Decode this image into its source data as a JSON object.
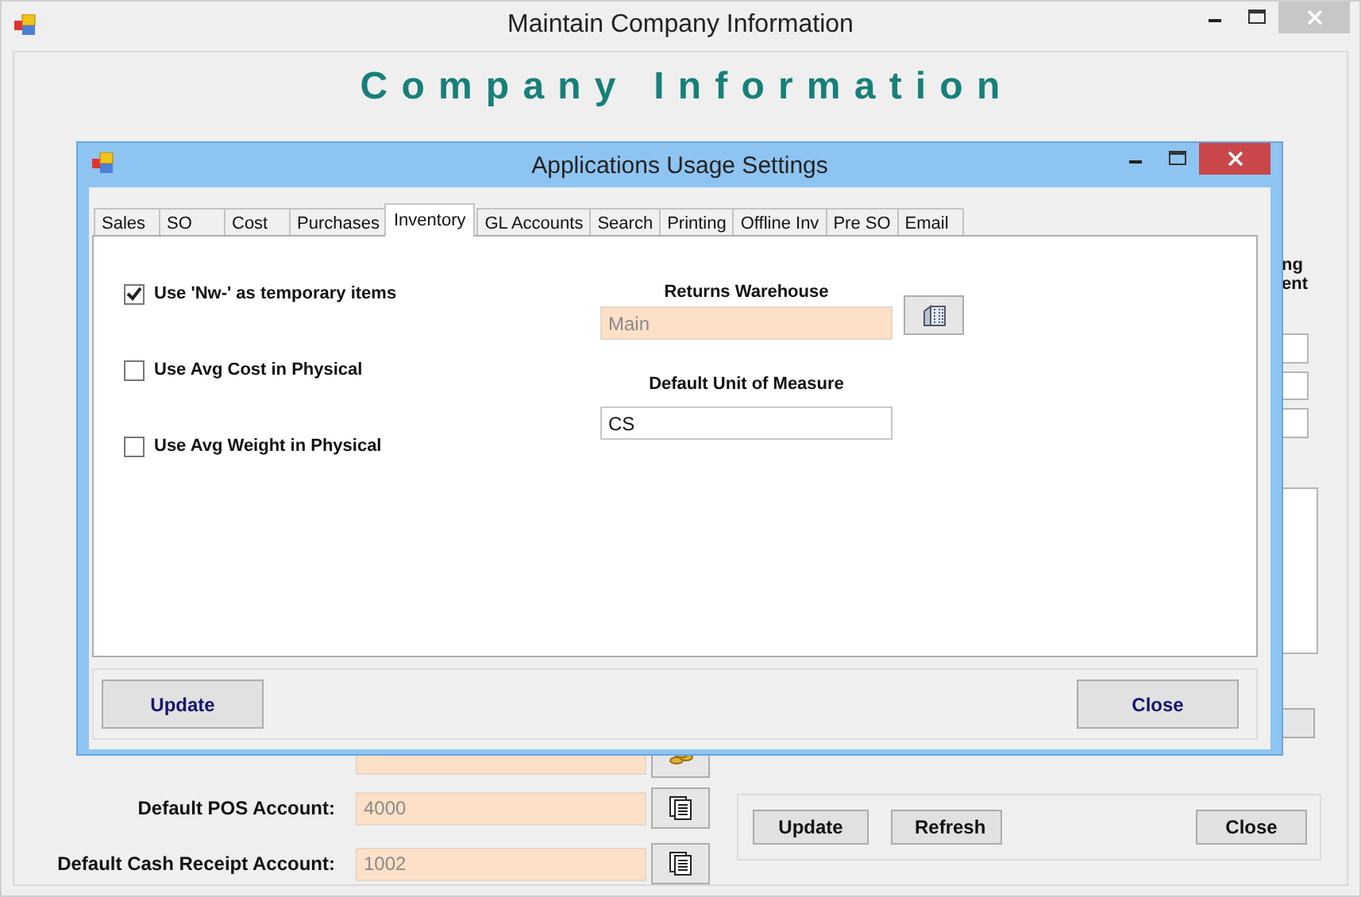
{
  "window": {
    "title": "Maintain Company Information"
  },
  "heading": "Company Information",
  "side_label": [
    "ng",
    "ent"
  ],
  "accounts": [
    {
      "label": "Default POS Account:",
      "value": "4000",
      "disabled": true
    },
    {
      "label": "Default Cash Receipt Account:",
      "value": "1002",
      "disabled": true
    }
  ],
  "buttons": [
    "Update",
    "Refresh",
    "Close"
  ],
  "dialog": {
    "title": "Applications Usage Settings",
    "tabs": [
      {
        "label": "Sales",
        "selected": false
      },
      {
        "label": "SO",
        "selected": false
      },
      {
        "label": "Cost",
        "selected": false
      },
      {
        "label": "Purchases",
        "selected": false
      },
      {
        "label": "Inventory",
        "selected": true
      },
      {
        "label": "GL Accounts",
        "selected": false
      },
      {
        "label": "Search",
        "selected": false
      },
      {
        "label": "Printing",
        "selected": false
      },
      {
        "label": "Offline Inv",
        "selected": false
      },
      {
        "label": "Pre SO",
        "selected": false
      },
      {
        "label": "Email",
        "selected": false
      }
    ],
    "options": [
      {
        "label": "Use 'Nw-' as temporary items",
        "checked": true
      },
      {
        "label": "Use Avg Cost in Physical",
        "checked": false
      },
      {
        "label": "Use Avg Weight in Physical",
        "checked": false
      }
    ],
    "returns_warehouse": {
      "label": "Returns Warehouse",
      "value": "Main",
      "disabled": true
    },
    "unit_of_measure": {
      "label": "Default Unit of Measure",
      "value": "CS",
      "disabled": false
    },
    "buttons": [
      "Update",
      "Close"
    ]
  }
}
